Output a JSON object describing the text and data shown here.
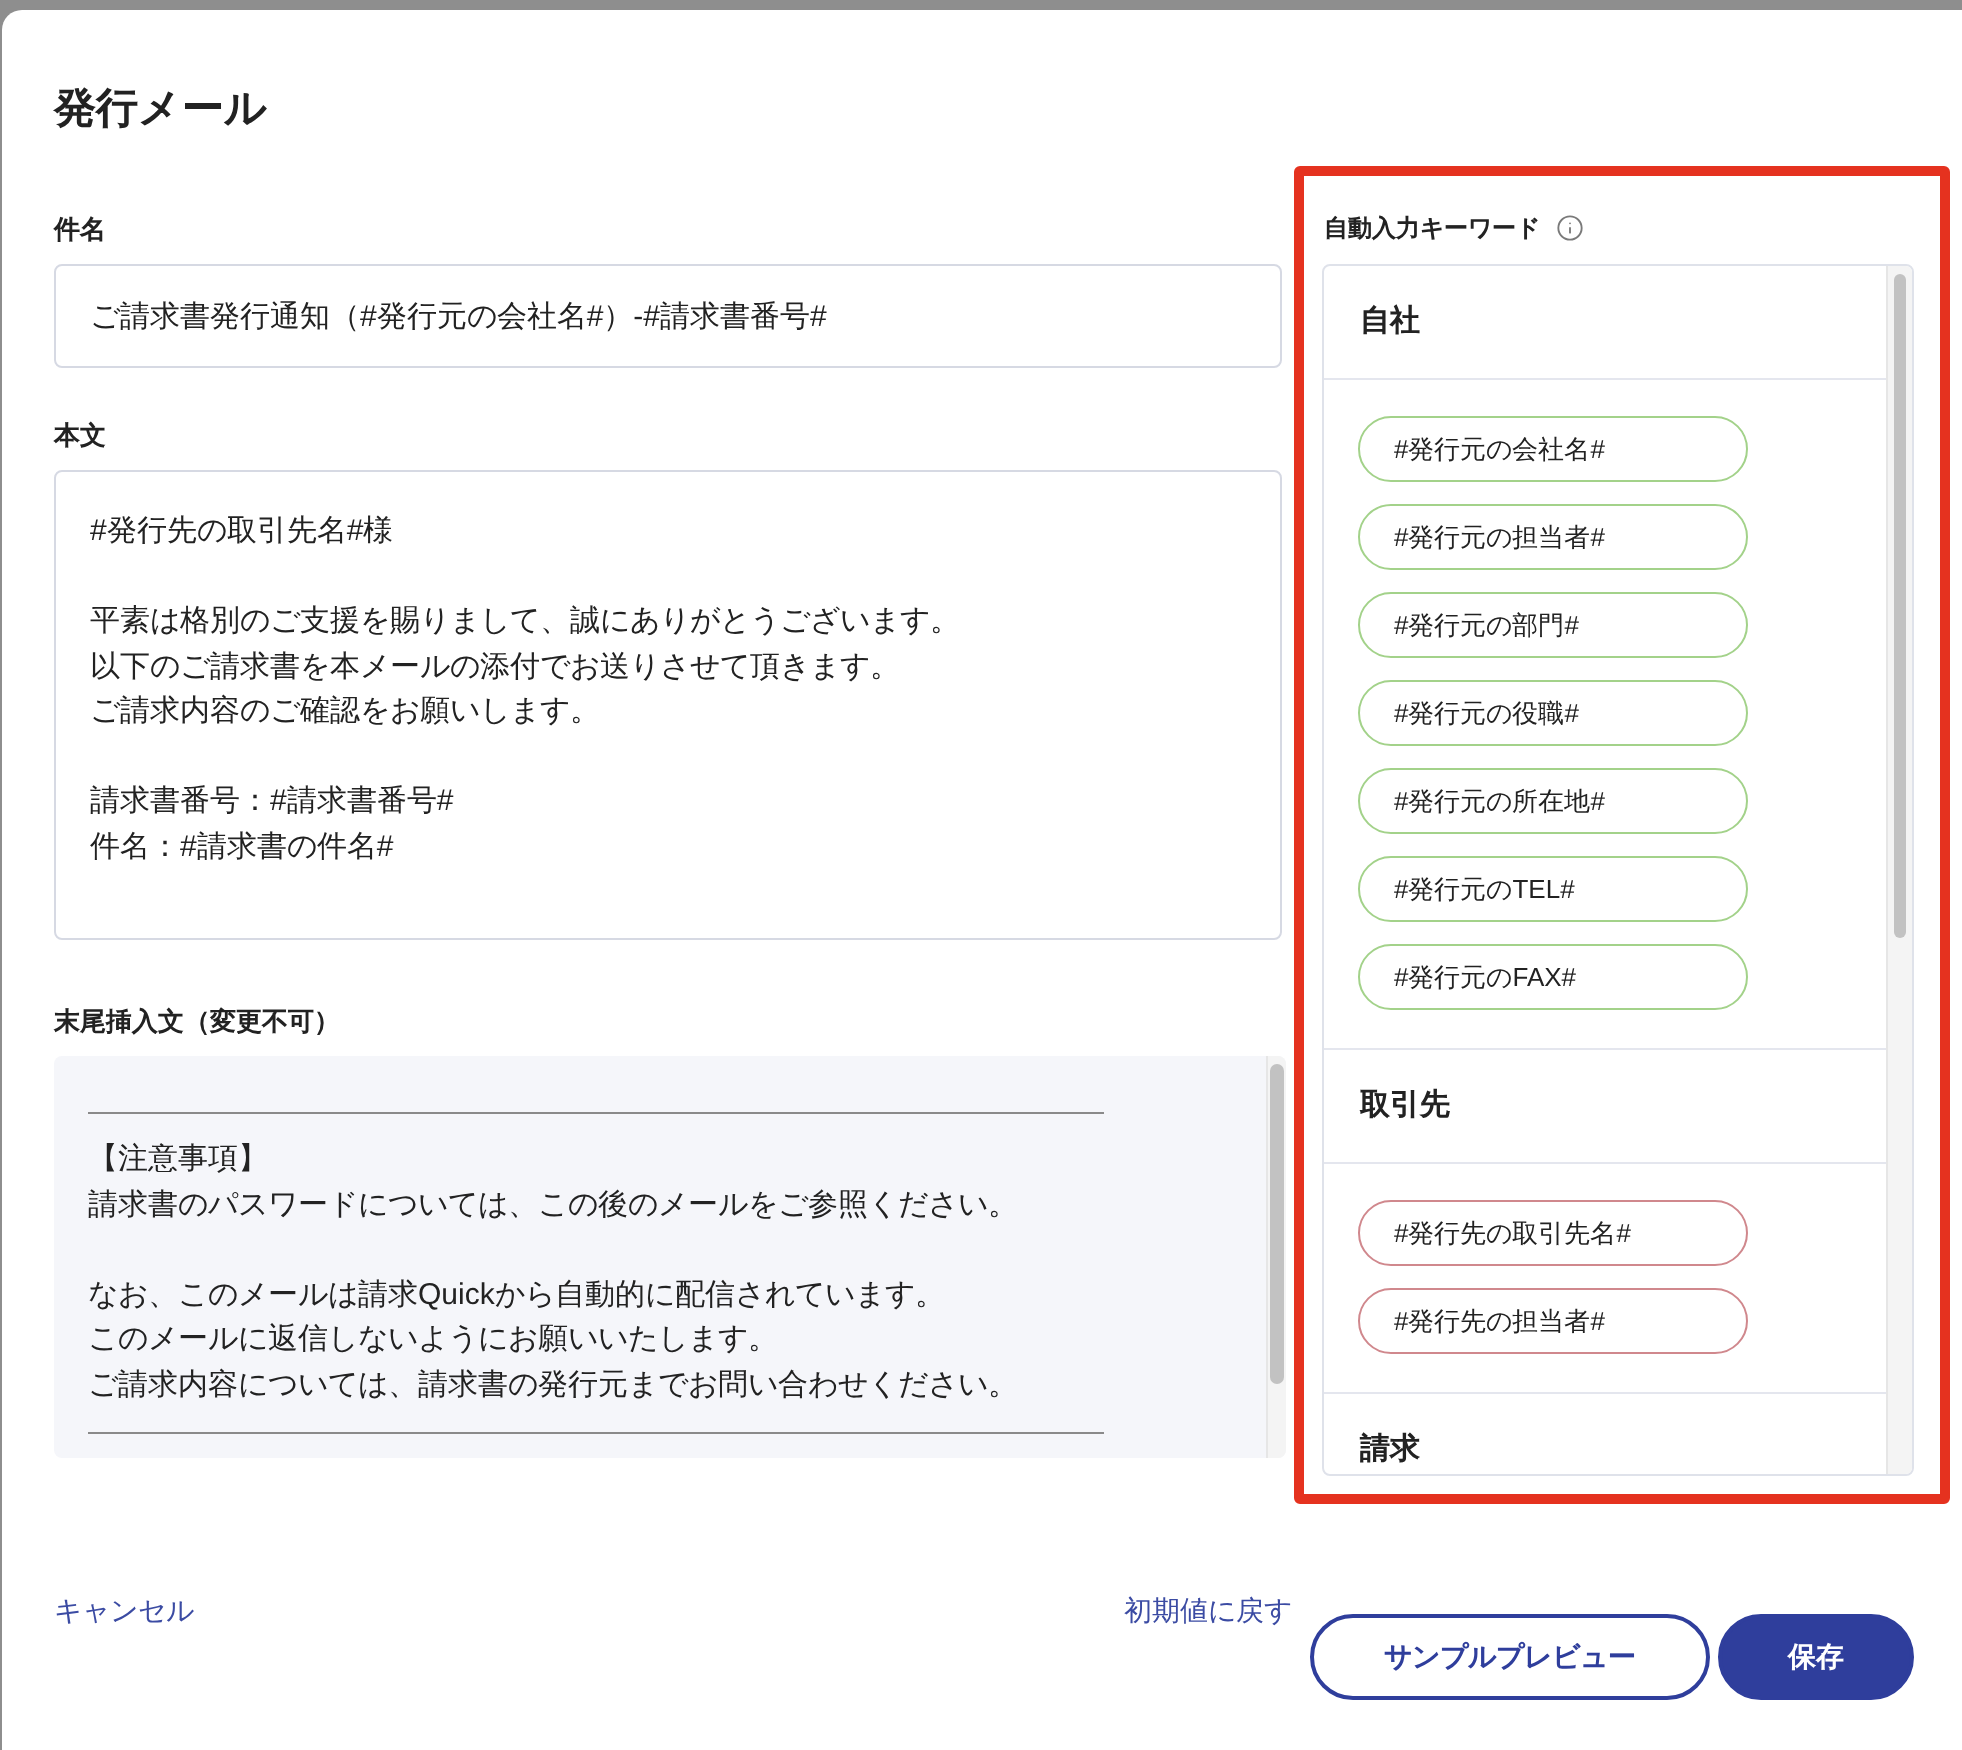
{
  "dialog": {
    "title": "発行メール"
  },
  "subject": {
    "label": "件名",
    "value": "ご請求書発行通知（#発行元の会社名#）-#請求書番号#"
  },
  "body": {
    "label": "本文",
    "paragraphs": [
      [
        "#発行先の取引先名#様"
      ],
      [
        "平素は格別のご支援を賜りまして、誠にありがとうございます。",
        "以下のご請求書を本メールの添付でお送りさせて頂きます。",
        "ご請求内容のご確認をお願いします。"
      ],
      [
        "請求書番号：#請求書番号#",
        "件名：#請求書の件名#"
      ]
    ]
  },
  "footer_text": {
    "label": "末尾挿入文（変更不可）",
    "paragraphs": [
      [
        "【注意事項】",
        "請求書のパスワードについては、この後のメールをご参照ください。"
      ],
      [
        "なお、このメールは請求Quickから自動的に配信されています。",
        "このメールに返信しないようにお願いいたします。",
        "ご請求内容については、請求書の発行元までお問い合わせください。"
      ]
    ]
  },
  "keywords": {
    "label": "自動入力キーワード",
    "sections": [
      {
        "title": "自社",
        "color": "#a3d28a",
        "items": [
          "#発行元の会社名#",
          "#発行元の担当者#",
          "#発行元の部門#",
          "#発行元の役職#",
          "#発行元の所在地#",
          "#発行元のTEL#",
          "#発行元のFAX#"
        ]
      },
      {
        "title": "取引先",
        "color": "#d0888d",
        "items": [
          "#発行先の取引先名#",
          "#発行先の担当者#"
        ]
      },
      {
        "title": "請求"
      }
    ]
  },
  "actions": {
    "cancel": "キャンセル",
    "reset": "初期値に戻す",
    "preview": "サンプルプレビュー",
    "save": "保存"
  }
}
